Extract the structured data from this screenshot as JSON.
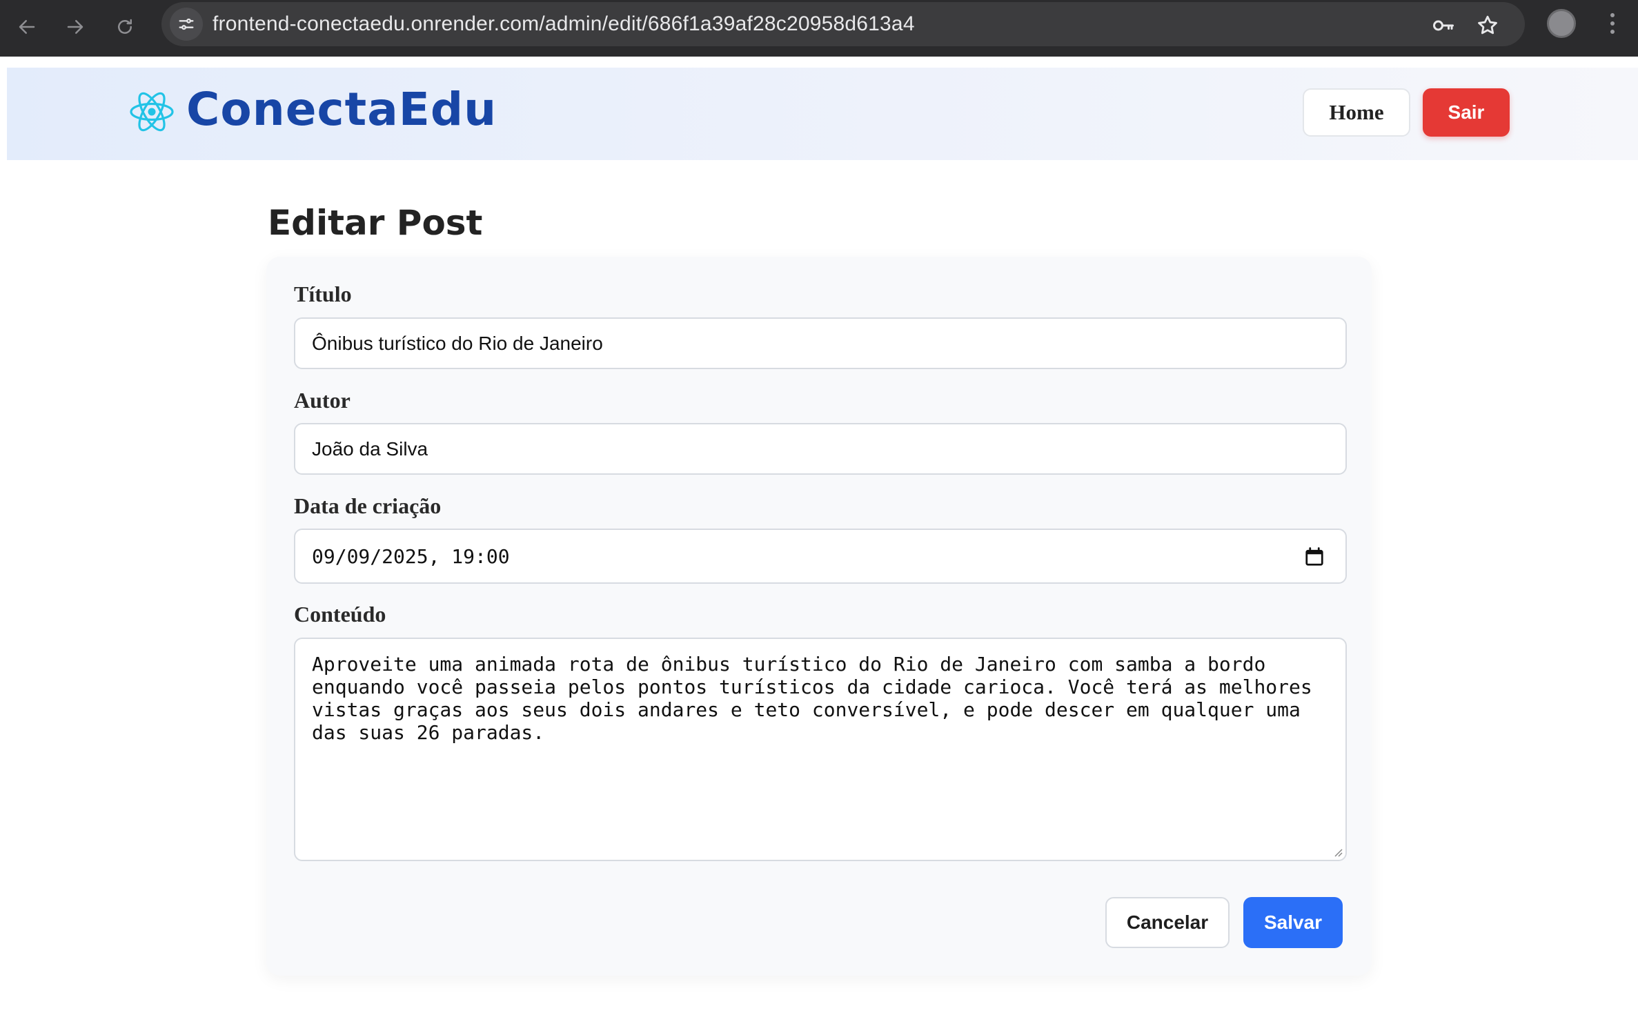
{
  "browser": {
    "url": "frontend-conectaedu.onrender.com/admin/edit/686f1a39af28c20958d613a4",
    "icons": [
      "back-arrow-icon",
      "forward-arrow-icon",
      "reload-icon",
      "site-settings-icon",
      "password-key-icon",
      "bookmark-star-icon",
      "profile-avatar",
      "menu-kebab-icon"
    ]
  },
  "header": {
    "logo_text": "ConectaEdu",
    "logo_icon": "atom-icon",
    "home_label": "Home",
    "logout_label": "Sair",
    "colors": {
      "brand": "#1846a6",
      "logo_icon": "#22c3e6",
      "logout": "#e53935"
    }
  },
  "page": {
    "title": "Editar Post"
  },
  "form": {
    "title_label": "Título",
    "title_value": "Ônibus turístico do Rio de Janeiro",
    "author_label": "Autor",
    "author_value": "João da Silva",
    "date_label": "Data de criação",
    "date_value": "09/09/2025, 19:00",
    "content_label": "Conteúdo",
    "content_value": "Aproveite uma animada rota de ônibus turístico do Rio de Janeiro com samba a bordo\nenquando você passeia pelos pontos turísticos da cidade carioca. Você terá as melhores\nvistas graças aos seus dois andares e teto conversível, e pode descer em qualquer uma\ndas suas 26 paradas.",
    "cancel_label": "Cancelar",
    "save_label": "Salvar",
    "colors": {
      "save": "#2b6ff7"
    }
  }
}
